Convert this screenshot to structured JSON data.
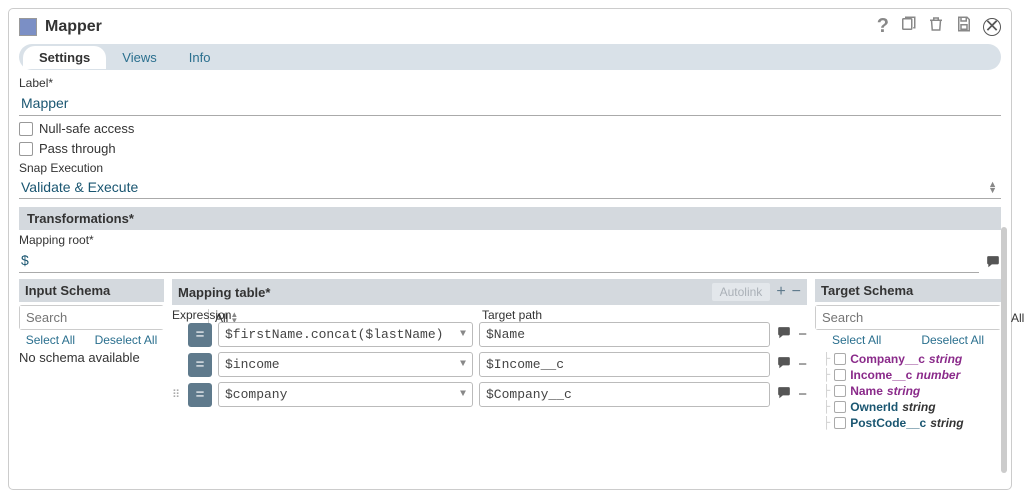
{
  "header": {
    "title": "Mapper",
    "icons": {
      "help": "?",
      "copy": "⎘",
      "trash": "🗑",
      "save": "💾",
      "close": "✕"
    }
  },
  "tabs": [
    "Settings",
    "Views",
    "Info"
  ],
  "activeTab": 0,
  "fields": {
    "label_label": "Label*",
    "label_value": "Mapper",
    "null_safe_label": "Null-safe access",
    "pass_through_label": "Pass through",
    "snap_exec_label": "Snap Execution",
    "snap_exec_value": "Validate & Execute"
  },
  "transformations": {
    "section_title": "Transformations*",
    "mapping_root_label": "Mapping root*",
    "mapping_root_value": "$"
  },
  "input_schema": {
    "title": "Input Schema",
    "search_placeholder": "Search",
    "all_label": "All",
    "select_all": "Select All",
    "deselect_all": "Deselect All",
    "empty": "No schema available"
  },
  "mapping_table": {
    "title": "Mapping table*",
    "autolink": "Autolink",
    "col_expression": "Expression",
    "col_target": "Target path",
    "rows": [
      {
        "expr": "$firstName.concat($lastName)",
        "target": "$Name",
        "draggable": false
      },
      {
        "expr": "$income",
        "target": "$Income__c",
        "draggable": false
      },
      {
        "expr": "$company",
        "target": "$Company__c",
        "draggable": true
      }
    ]
  },
  "target_schema": {
    "title": "Target Schema",
    "search_placeholder": "Search",
    "all_label": "All",
    "select_all": "Select All",
    "deselect_all": "Deselect All",
    "items": [
      {
        "name": "Company__c",
        "type": "string",
        "highlighted": true
      },
      {
        "name": "Income__c",
        "type": "number",
        "highlighted": true
      },
      {
        "name": "Name",
        "type": "string",
        "highlighted": true
      },
      {
        "name": "OwnerId",
        "type": "string",
        "highlighted": false
      },
      {
        "name": "PostCode__c",
        "type": "string",
        "highlighted": false
      }
    ]
  }
}
